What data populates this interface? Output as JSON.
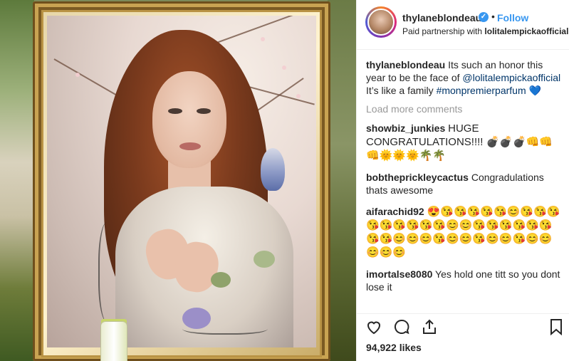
{
  "header": {
    "username": "thylaneblondeau",
    "separator": "•",
    "follow_label": "Follow",
    "partnership_prefix": "Paid partnership with",
    "partner": "lolitalempickaofficial"
  },
  "caption": {
    "username": "thylaneblondeau",
    "text_1": "Its such an honor this year to be the face of",
    "mention": "@lolitalempickaofficial",
    "text_2": "It’s like a family",
    "hashtag": "#monpremierparfum",
    "emoji": "💙"
  },
  "load_more_label": "Load more comments",
  "comments": [
    {
      "username": "showbiz_junkies",
      "text": "HUGE CONGRATULATIONS!!!! 💣💣💣👊👊👊🌞🌞🌞🌴🌴"
    },
    {
      "username": "bobthepricklеycactus",
      "text": "Congradulations thats awesome"
    },
    {
      "username": "aifarachid92",
      "text": "😍😘😘😘😘😘😊😘😘😘😘😘😘😘😘😘😊😊😘😘😘😘😘😘😘😘😊😊😊😘😊😊😘😊😊😘😊😊😊😊😊"
    },
    {
      "username": "imortalse8080",
      "text": "Yes hold one titt so you dont lose it"
    }
  ],
  "likes_label": "94,922 likes",
  "icons": {
    "like": "heart-outline-icon",
    "comment": "comment-bubble-icon",
    "share": "share-upload-icon",
    "save": "bookmark-icon"
  },
  "colors": {
    "link": "#3897f0",
    "mention": "#003569",
    "muted": "#999999"
  }
}
